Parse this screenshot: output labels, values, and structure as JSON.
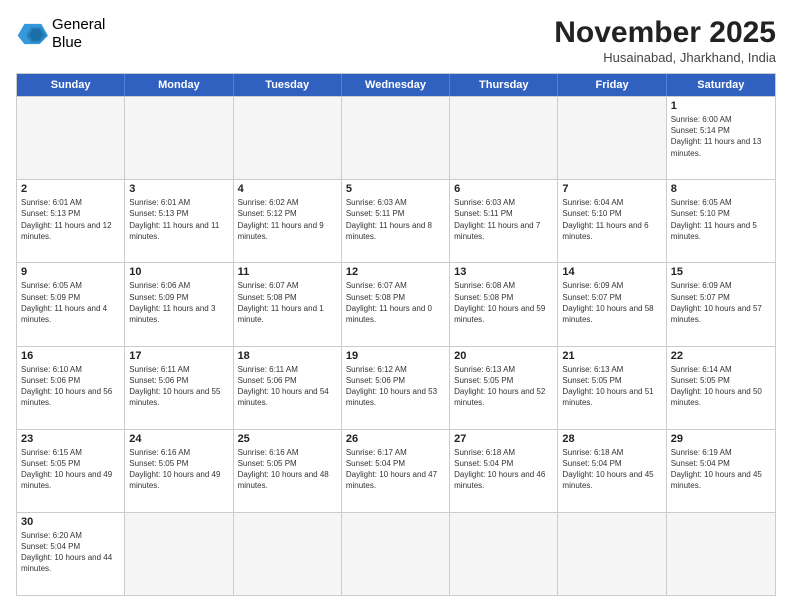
{
  "logo": {
    "line1": "General",
    "line2": "Blue"
  },
  "title": "November 2025",
  "subtitle": "Husainabad, Jharkhand, India",
  "weekdays": [
    "Sunday",
    "Monday",
    "Tuesday",
    "Wednesday",
    "Thursday",
    "Friday",
    "Saturday"
  ],
  "rows": [
    [
      {
        "day": "",
        "info": ""
      },
      {
        "day": "",
        "info": ""
      },
      {
        "day": "",
        "info": ""
      },
      {
        "day": "",
        "info": ""
      },
      {
        "day": "",
        "info": ""
      },
      {
        "day": "",
        "info": ""
      },
      {
        "day": "1",
        "info": "Sunrise: 6:00 AM\nSunset: 5:14 PM\nDaylight: 11 hours and 13 minutes."
      }
    ],
    [
      {
        "day": "2",
        "info": "Sunrise: 6:01 AM\nSunset: 5:13 PM\nDaylight: 11 hours and 12 minutes."
      },
      {
        "day": "3",
        "info": "Sunrise: 6:01 AM\nSunset: 5:13 PM\nDaylight: 11 hours and 11 minutes."
      },
      {
        "day": "4",
        "info": "Sunrise: 6:02 AM\nSunset: 5:12 PM\nDaylight: 11 hours and 9 minutes."
      },
      {
        "day": "5",
        "info": "Sunrise: 6:03 AM\nSunset: 5:11 PM\nDaylight: 11 hours and 8 minutes."
      },
      {
        "day": "6",
        "info": "Sunrise: 6:03 AM\nSunset: 5:11 PM\nDaylight: 11 hours and 7 minutes."
      },
      {
        "day": "7",
        "info": "Sunrise: 6:04 AM\nSunset: 5:10 PM\nDaylight: 11 hours and 6 minutes."
      },
      {
        "day": "8",
        "info": "Sunrise: 6:05 AM\nSunset: 5:10 PM\nDaylight: 11 hours and 5 minutes."
      }
    ],
    [
      {
        "day": "9",
        "info": "Sunrise: 6:05 AM\nSunset: 5:09 PM\nDaylight: 11 hours and 4 minutes."
      },
      {
        "day": "10",
        "info": "Sunrise: 6:06 AM\nSunset: 5:09 PM\nDaylight: 11 hours and 3 minutes."
      },
      {
        "day": "11",
        "info": "Sunrise: 6:07 AM\nSunset: 5:08 PM\nDaylight: 11 hours and 1 minute."
      },
      {
        "day": "12",
        "info": "Sunrise: 6:07 AM\nSunset: 5:08 PM\nDaylight: 11 hours and 0 minutes."
      },
      {
        "day": "13",
        "info": "Sunrise: 6:08 AM\nSunset: 5:08 PM\nDaylight: 10 hours and 59 minutes."
      },
      {
        "day": "14",
        "info": "Sunrise: 6:09 AM\nSunset: 5:07 PM\nDaylight: 10 hours and 58 minutes."
      },
      {
        "day": "15",
        "info": "Sunrise: 6:09 AM\nSunset: 5:07 PM\nDaylight: 10 hours and 57 minutes."
      }
    ],
    [
      {
        "day": "16",
        "info": "Sunrise: 6:10 AM\nSunset: 5:06 PM\nDaylight: 10 hours and 56 minutes."
      },
      {
        "day": "17",
        "info": "Sunrise: 6:11 AM\nSunset: 5:06 PM\nDaylight: 10 hours and 55 minutes."
      },
      {
        "day": "18",
        "info": "Sunrise: 6:11 AM\nSunset: 5:06 PM\nDaylight: 10 hours and 54 minutes."
      },
      {
        "day": "19",
        "info": "Sunrise: 6:12 AM\nSunset: 5:06 PM\nDaylight: 10 hours and 53 minutes."
      },
      {
        "day": "20",
        "info": "Sunrise: 6:13 AM\nSunset: 5:05 PM\nDaylight: 10 hours and 52 minutes."
      },
      {
        "day": "21",
        "info": "Sunrise: 6:13 AM\nSunset: 5:05 PM\nDaylight: 10 hours and 51 minutes."
      },
      {
        "day": "22",
        "info": "Sunrise: 6:14 AM\nSunset: 5:05 PM\nDaylight: 10 hours and 50 minutes."
      }
    ],
    [
      {
        "day": "23",
        "info": "Sunrise: 6:15 AM\nSunset: 5:05 PM\nDaylight: 10 hours and 49 minutes."
      },
      {
        "day": "24",
        "info": "Sunrise: 6:16 AM\nSunset: 5:05 PM\nDaylight: 10 hours and 49 minutes."
      },
      {
        "day": "25",
        "info": "Sunrise: 6:16 AM\nSunset: 5:05 PM\nDaylight: 10 hours and 48 minutes."
      },
      {
        "day": "26",
        "info": "Sunrise: 6:17 AM\nSunset: 5:04 PM\nDaylight: 10 hours and 47 minutes."
      },
      {
        "day": "27",
        "info": "Sunrise: 6:18 AM\nSunset: 5:04 PM\nDaylight: 10 hours and 46 minutes."
      },
      {
        "day": "28",
        "info": "Sunrise: 6:18 AM\nSunset: 5:04 PM\nDaylight: 10 hours and 45 minutes."
      },
      {
        "day": "29",
        "info": "Sunrise: 6:19 AM\nSunset: 5:04 PM\nDaylight: 10 hours and 45 minutes."
      }
    ],
    [
      {
        "day": "30",
        "info": "Sunrise: 6:20 AM\nSunset: 5:04 PM\nDaylight: 10 hours and 44 minutes."
      },
      {
        "day": "",
        "info": ""
      },
      {
        "day": "",
        "info": ""
      },
      {
        "day": "",
        "info": ""
      },
      {
        "day": "",
        "info": ""
      },
      {
        "day": "",
        "info": ""
      },
      {
        "day": "",
        "info": ""
      }
    ]
  ]
}
